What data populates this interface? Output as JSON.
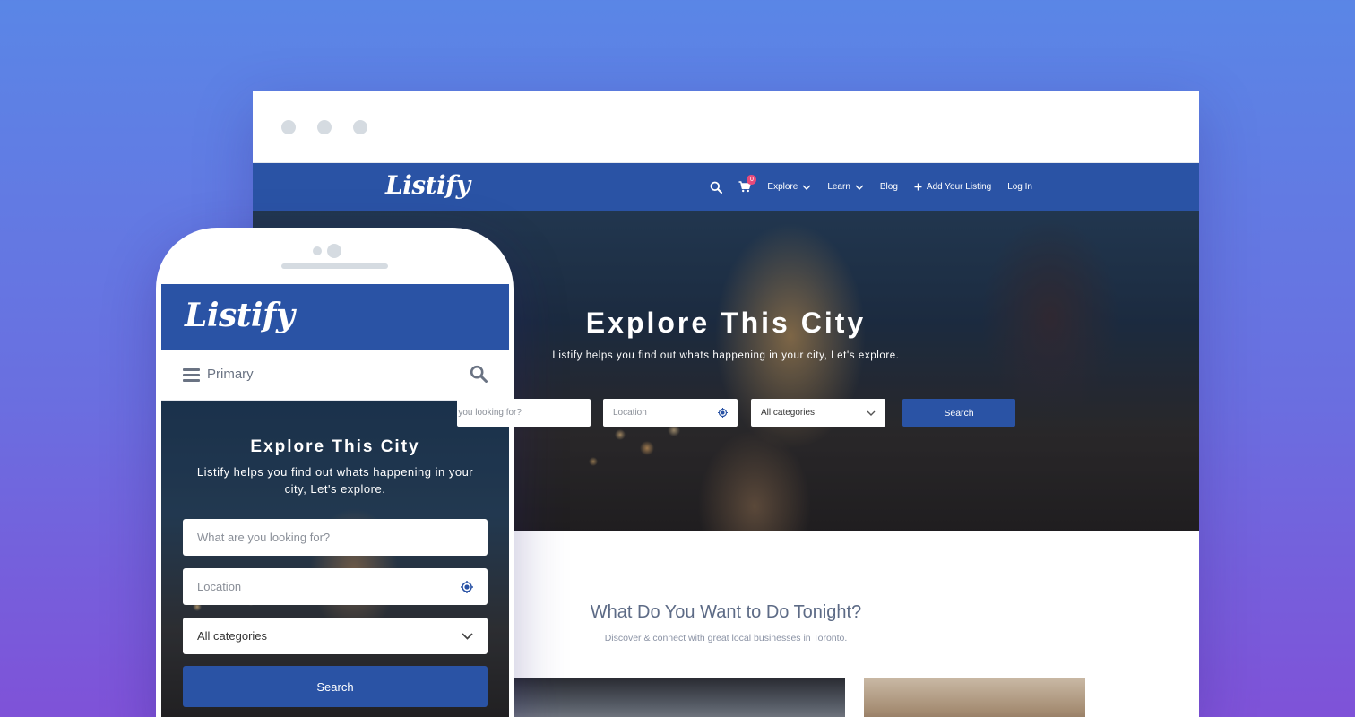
{
  "brand": {
    "logo_text": "Listify",
    "primary_color": "#2a53a5",
    "badge_color": "#e84a7a"
  },
  "desktop": {
    "nav": {
      "cart_count": "0",
      "explore_label": "Explore",
      "learn_label": "Learn",
      "blog_label": "Blog",
      "add_listing_label": "Add Your Listing",
      "login_label": "Log In"
    },
    "hero": {
      "title": "Explore This City",
      "subtitle": "Listify helps you find out whats happening in your city, Let's explore.",
      "what_placeholder": "What are you looking for?",
      "location_placeholder": "Location",
      "category_selected": "All categories",
      "search_button": "Search"
    },
    "section": {
      "title": "What Do You Want to Do Tonight?",
      "subtitle": "Discover & connect with great local businesses in Toronto."
    }
  },
  "mobile": {
    "menu_label": "Primary",
    "hero": {
      "title": "Explore This City",
      "subtitle": "Listify helps you find out whats happening in your city, Let's explore.",
      "what_placeholder": "What are you looking for?",
      "location_placeholder": "Location",
      "category_selected": "All categories",
      "search_button": "Search"
    }
  },
  "icons": [
    "search-icon",
    "cart-icon",
    "chevron-down-icon",
    "plus-icon",
    "location-target-icon",
    "hamburger-icon"
  ]
}
